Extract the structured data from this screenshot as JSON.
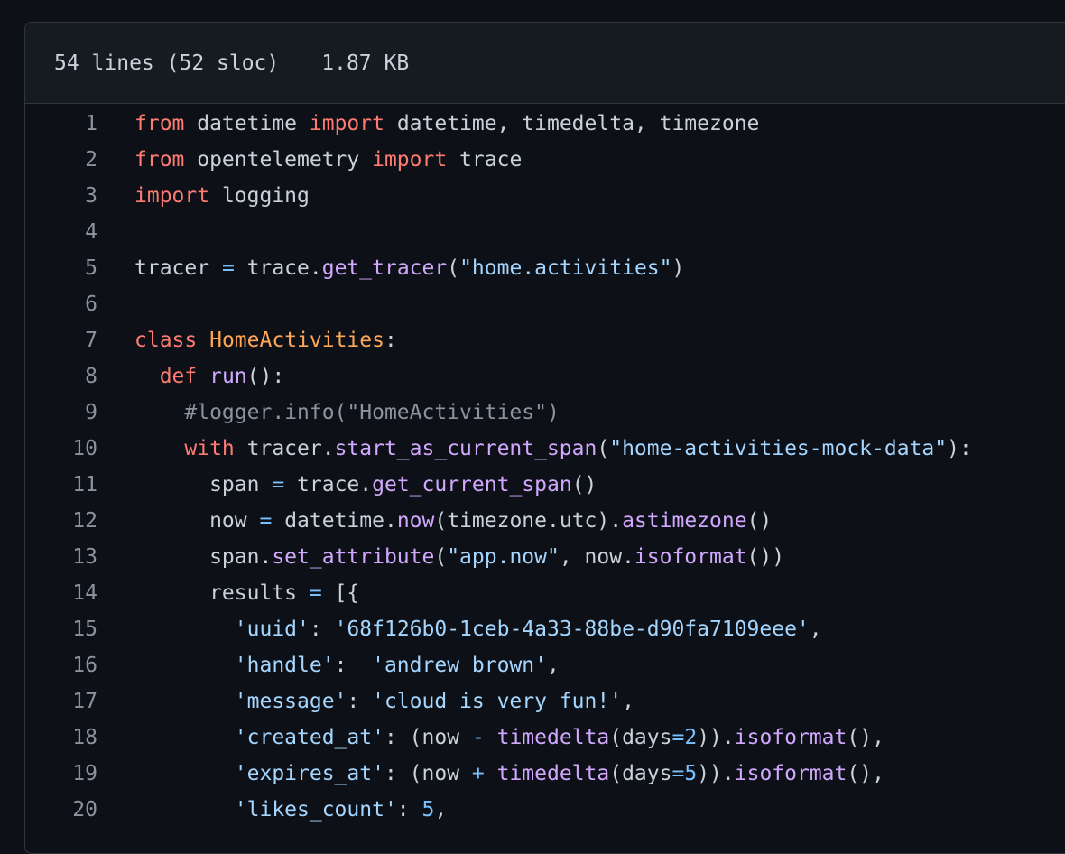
{
  "file_info": {
    "lines_label": "54 lines (52 sloc)",
    "size_label": "1.87 KB"
  },
  "code_lines": [
    {
      "n": "1",
      "tokens": [
        {
          "t": "from",
          "c": "kw"
        },
        {
          "t": " datetime ",
          "c": ""
        },
        {
          "t": "import",
          "c": "kw"
        },
        {
          "t": " datetime, timedelta, timezone",
          "c": ""
        }
      ]
    },
    {
      "n": "2",
      "tokens": [
        {
          "t": "from",
          "c": "kw"
        },
        {
          "t": " opentelemetry ",
          "c": ""
        },
        {
          "t": "import",
          "c": "kw"
        },
        {
          "t": " trace",
          "c": ""
        }
      ]
    },
    {
      "n": "3",
      "tokens": [
        {
          "t": "import",
          "c": "kw"
        },
        {
          "t": " logging",
          "c": ""
        }
      ]
    },
    {
      "n": "4",
      "tokens": []
    },
    {
      "n": "5",
      "tokens": [
        {
          "t": "tracer ",
          "c": ""
        },
        {
          "t": "=",
          "c": "op"
        },
        {
          "t": " trace.",
          "c": ""
        },
        {
          "t": "get_tracer",
          "c": "fn"
        },
        {
          "t": "(",
          "c": ""
        },
        {
          "t": "\"home.activities\"",
          "c": "st"
        },
        {
          "t": ")",
          "c": ""
        }
      ]
    },
    {
      "n": "6",
      "tokens": []
    },
    {
      "n": "7",
      "tokens": [
        {
          "t": "class",
          "c": "kw"
        },
        {
          "t": " ",
          "c": ""
        },
        {
          "t": "HomeActivities",
          "c": "cl"
        },
        {
          "t": ":",
          "c": ""
        }
      ]
    },
    {
      "n": "8",
      "tokens": [
        {
          "t": "  ",
          "c": ""
        },
        {
          "t": "def",
          "c": "kw"
        },
        {
          "t": " ",
          "c": ""
        },
        {
          "t": "run",
          "c": "fn"
        },
        {
          "t": "():",
          "c": ""
        }
      ]
    },
    {
      "n": "9",
      "tokens": [
        {
          "t": "    ",
          "c": ""
        },
        {
          "t": "#logger.info(\"HomeActivities\")",
          "c": "cm"
        }
      ]
    },
    {
      "n": "10",
      "tokens": [
        {
          "t": "    ",
          "c": ""
        },
        {
          "t": "with",
          "c": "kw"
        },
        {
          "t": " tracer.",
          "c": ""
        },
        {
          "t": "start_as_current_span",
          "c": "fn"
        },
        {
          "t": "(",
          "c": ""
        },
        {
          "t": "\"home-activities-mock-data\"",
          "c": "st"
        },
        {
          "t": "):",
          "c": ""
        }
      ]
    },
    {
      "n": "11",
      "tokens": [
        {
          "t": "      span ",
          "c": ""
        },
        {
          "t": "=",
          "c": "op"
        },
        {
          "t": " trace.",
          "c": ""
        },
        {
          "t": "get_current_span",
          "c": "fn"
        },
        {
          "t": "()",
          "c": ""
        }
      ]
    },
    {
      "n": "12",
      "tokens": [
        {
          "t": "      now ",
          "c": ""
        },
        {
          "t": "=",
          "c": "op"
        },
        {
          "t": " datetime.",
          "c": ""
        },
        {
          "t": "now",
          "c": "fn"
        },
        {
          "t": "(timezone.utc).",
          "c": ""
        },
        {
          "t": "astimezone",
          "c": "fn"
        },
        {
          "t": "()",
          "c": ""
        }
      ]
    },
    {
      "n": "13",
      "tokens": [
        {
          "t": "      span.",
          "c": ""
        },
        {
          "t": "set_attribute",
          "c": "fn"
        },
        {
          "t": "(",
          "c": ""
        },
        {
          "t": "\"app.now\"",
          "c": "st"
        },
        {
          "t": ", now.",
          "c": ""
        },
        {
          "t": "isoformat",
          "c": "fn"
        },
        {
          "t": "())",
          "c": ""
        }
      ]
    },
    {
      "n": "14",
      "tokens": [
        {
          "t": "      results ",
          "c": ""
        },
        {
          "t": "=",
          "c": "op"
        },
        {
          "t": " [{",
          "c": ""
        }
      ]
    },
    {
      "n": "15",
      "tokens": [
        {
          "t": "        ",
          "c": ""
        },
        {
          "t": "'uuid'",
          "c": "st"
        },
        {
          "t": ": ",
          "c": ""
        },
        {
          "t": "'68f126b0-1ceb-4a33-88be-d90fa7109eee'",
          "c": "st"
        },
        {
          "t": ",",
          "c": ""
        }
      ]
    },
    {
      "n": "16",
      "tokens": [
        {
          "t": "        ",
          "c": ""
        },
        {
          "t": "'handle'",
          "c": "st"
        },
        {
          "t": ":  ",
          "c": ""
        },
        {
          "t": "'andrew brown'",
          "c": "st"
        },
        {
          "t": ",",
          "c": ""
        }
      ]
    },
    {
      "n": "17",
      "tokens": [
        {
          "t": "        ",
          "c": ""
        },
        {
          "t": "'message'",
          "c": "st"
        },
        {
          "t": ": ",
          "c": ""
        },
        {
          "t": "'cloud is very fun!'",
          "c": "st"
        },
        {
          "t": ",",
          "c": ""
        }
      ]
    },
    {
      "n": "18",
      "tokens": [
        {
          "t": "        ",
          "c": ""
        },
        {
          "t": "'created_at'",
          "c": "st"
        },
        {
          "t": ": (now ",
          "c": ""
        },
        {
          "t": "-",
          "c": "op"
        },
        {
          "t": " ",
          "c": ""
        },
        {
          "t": "timedelta",
          "c": "fn"
        },
        {
          "t": "(days",
          "c": ""
        },
        {
          "t": "=",
          "c": "op"
        },
        {
          "t": "2",
          "c": "nu"
        },
        {
          "t": ")).",
          "c": ""
        },
        {
          "t": "isoformat",
          "c": "fn"
        },
        {
          "t": "(),",
          "c": ""
        }
      ]
    },
    {
      "n": "19",
      "tokens": [
        {
          "t": "        ",
          "c": ""
        },
        {
          "t": "'expires_at'",
          "c": "st"
        },
        {
          "t": ": (now ",
          "c": ""
        },
        {
          "t": "+",
          "c": "op"
        },
        {
          "t": " ",
          "c": ""
        },
        {
          "t": "timedelta",
          "c": "fn"
        },
        {
          "t": "(days",
          "c": ""
        },
        {
          "t": "=",
          "c": "op"
        },
        {
          "t": "5",
          "c": "nu"
        },
        {
          "t": ")).",
          "c": ""
        },
        {
          "t": "isoformat",
          "c": "fn"
        },
        {
          "t": "(),",
          "c": ""
        }
      ]
    },
    {
      "n": "20",
      "tokens": [
        {
          "t": "        ",
          "c": ""
        },
        {
          "t": "'likes_count'",
          "c": "st"
        },
        {
          "t": ": ",
          "c": ""
        },
        {
          "t": "5",
          "c": "nu"
        },
        {
          "t": ",",
          "c": ""
        }
      ]
    }
  ]
}
